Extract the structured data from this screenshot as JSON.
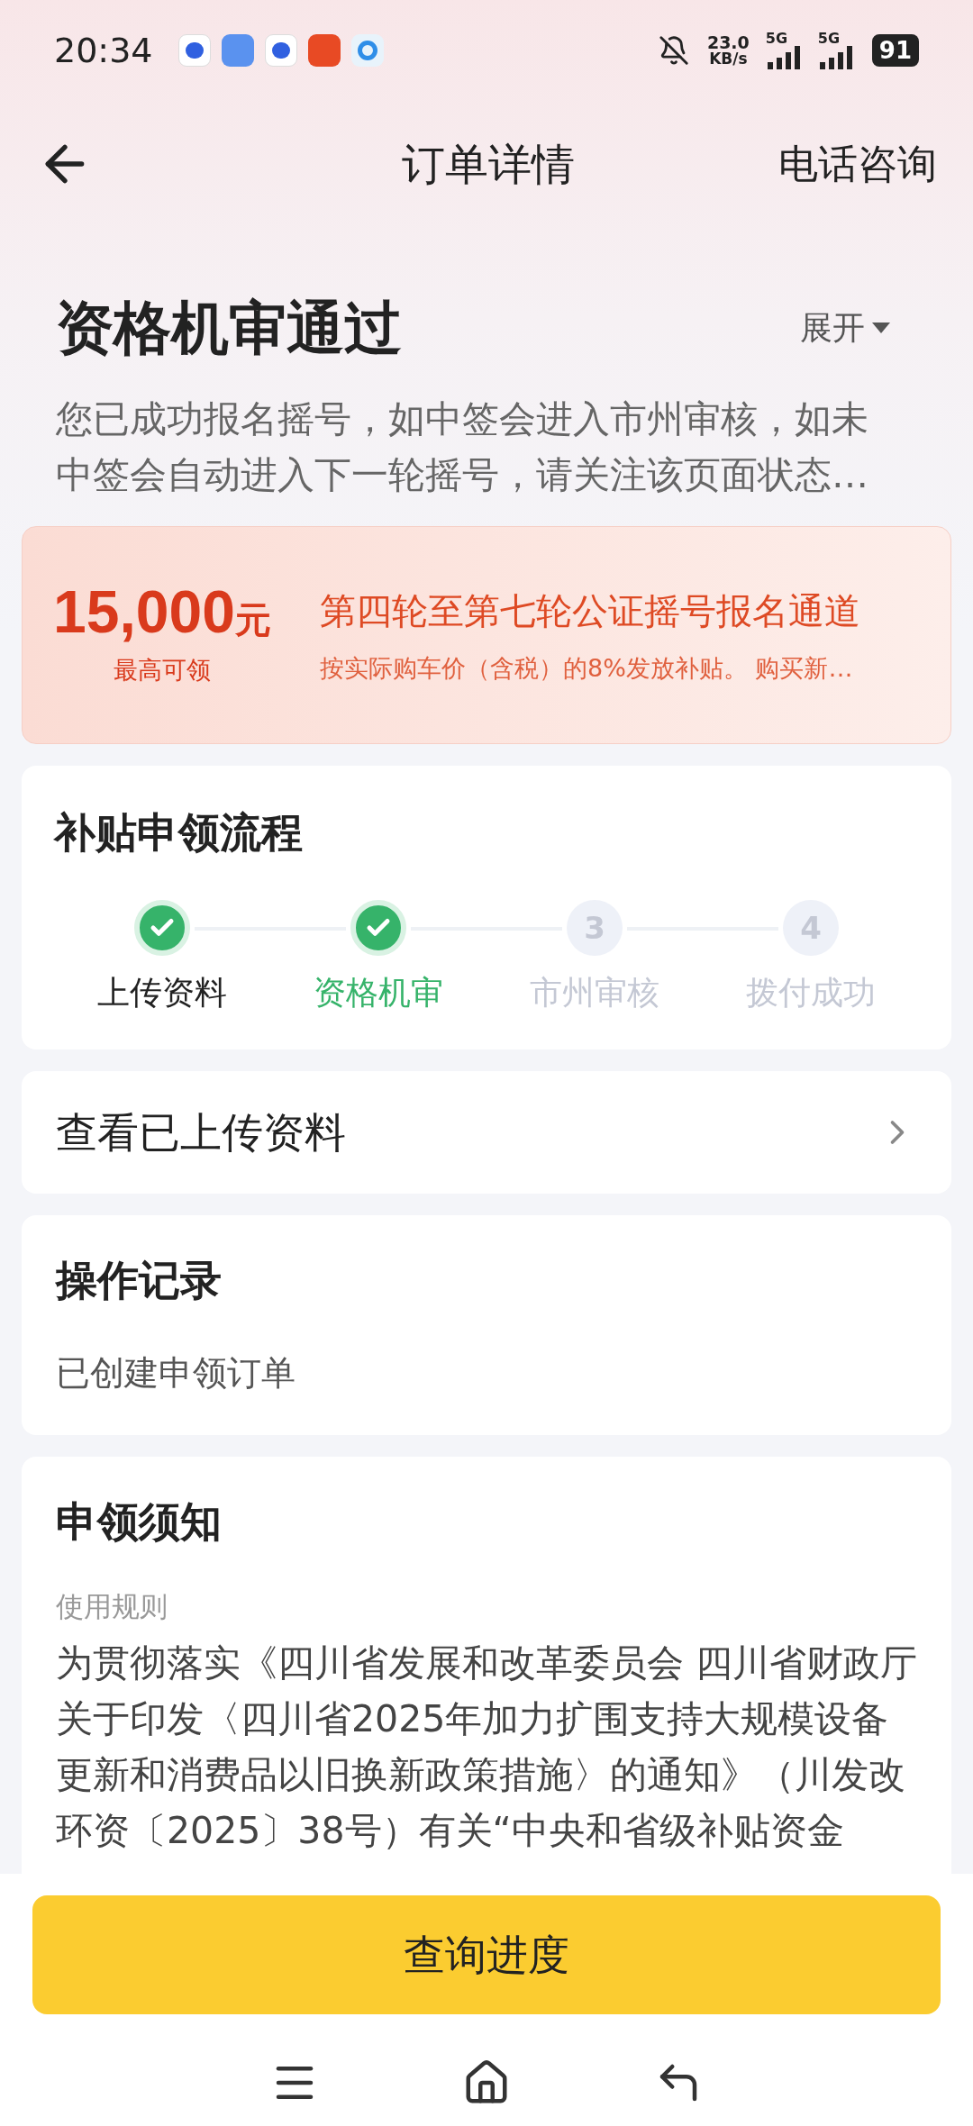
{
  "status_bar": {
    "time": "20:34",
    "speed_value": "23.0",
    "speed_unit": "KB/s",
    "sim1": "5G",
    "sim2": "5G",
    "battery": "91"
  },
  "header": {
    "title": "订单详情",
    "action": "电话咨询"
  },
  "status": {
    "title": "资格机审通过",
    "toggle": "展开",
    "description": "您已成功报名摇号，如中签会进入市州审核，如未中签会自动进入下一轮摇号，请关注该页面状态…"
  },
  "banner": {
    "amount": "15,000",
    "unit": "元",
    "amount_caption": "最高可领",
    "title": "第四轮至第七轮公证摇号报名通道",
    "subtitle": "按实际购车价（含税）的8%发放补贴。 购买新…"
  },
  "process": {
    "title": "补贴申领流程",
    "steps": [
      {
        "label": "上传资料",
        "kind": "done",
        "selected": false
      },
      {
        "label": "资格机审",
        "kind": "done",
        "selected": true
      },
      {
        "number": "3",
        "label": "市州审核",
        "kind": "pending",
        "selected": false
      },
      {
        "number": "4",
        "label": "拨付成功",
        "kind": "pending",
        "selected": false
      }
    ]
  },
  "uploaded": {
    "label": "查看已上传资料"
  },
  "records": {
    "title": "操作记录",
    "items": [
      "已创建申领订单"
    ]
  },
  "notice": {
    "title": "申领须知",
    "subtitle": "使用规则",
    "body": "为贯彻落实《四川省发展和改革委员会 四川省财政厅关于印发〈四川省2025年加力扩围支持大规模设备更新和消费品以旧换新政策措施〉的通知》（川发改环资〔2025〕38号）有关“中央和省级补贴资金"
  },
  "bottom_button": "查询进度"
}
